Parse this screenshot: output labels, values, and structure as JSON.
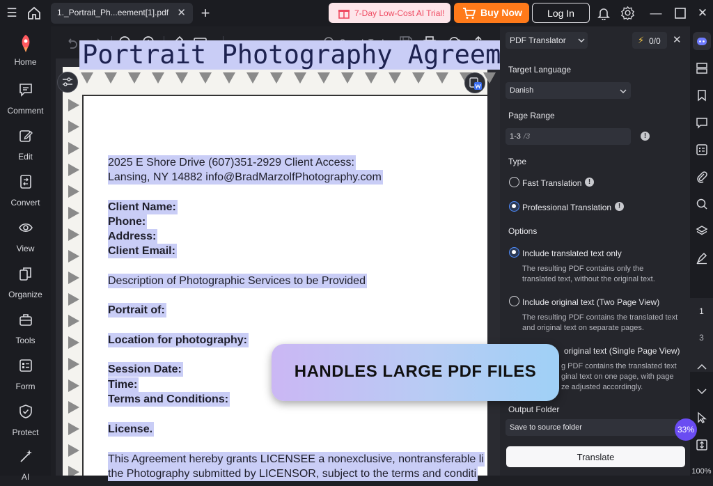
{
  "titlebar": {
    "tab_title": "1._Portrait_Ph...eement[1].pdf",
    "promo_label": "7-Day Low-Cost AI Trial!",
    "buy_label": "Buy Now",
    "login_label": "Log In"
  },
  "sidebar": {
    "items": [
      {
        "label": "Home"
      },
      {
        "label": "Comment"
      },
      {
        "label": "Edit"
      },
      {
        "label": "Convert"
      },
      {
        "label": "View"
      },
      {
        "label": "Organize"
      },
      {
        "label": "Tools"
      },
      {
        "label": "Form"
      },
      {
        "label": "Protect"
      },
      {
        "label": "AI"
      }
    ]
  },
  "toolbar": {
    "search_label": "Search Tools"
  },
  "document": {
    "title": "Portrait Photography Agreem",
    "lines": [
      "2025 E Shore Drive (607)351-2929 Client Access:",
      "Lansing, NY 14882 info@BradMarzolfPhotography.com",
      "Client Name:",
      "Phone:",
      "Address:",
      "Client Email:",
      "Description of Photographic Services to be Provided",
      "Portrait of:",
      "Location for photography:",
      "Session Date:",
      "Time:",
      "Terms and Conditions:",
      "License.",
      "This Agreement hereby grants LICENSEE a nonexclusive, nontransferable li",
      "the Photography submitted by LICENSOR, subject to the terms and conditi"
    ]
  },
  "panel": {
    "tool_name": "PDF Translator",
    "credits": "0/0",
    "target_language_label": "Target Language",
    "target_language_value": "Danish",
    "page_range_label": "Page Range",
    "page_range_value": "1-3",
    "page_range_total": "/3",
    "type_label": "Type",
    "type_fast": "Fast Translation",
    "type_professional": "Professional Translation",
    "options_label": "Options",
    "opt1_label": "Include translated text only",
    "opt1_desc1": "The resulting PDF contains only the",
    "opt1_desc2": "translated text, without the original text.",
    "opt2_label": "Include original text (Two Page View)",
    "opt2_desc1": "The resulting PDF contains the translated text",
    "opt2_desc2": "and original text on separate pages.",
    "opt3_label": "original text (Single Page View)",
    "opt3_desc1": "g PDF contains the translated text",
    "opt3_desc2": "ginal text on one page, with page",
    "opt3_desc3": "ze adjusted accordingly.",
    "output_label": "Output Folder",
    "output_value": "Save to source folder",
    "translate_label": "Translate"
  },
  "right_strip": {
    "page_current": "1",
    "page_total": "3",
    "zoom_partial": "100%",
    "progress_badge": "33%"
  },
  "banner": {
    "text": "HANDLES LARGE PDF FILES"
  }
}
